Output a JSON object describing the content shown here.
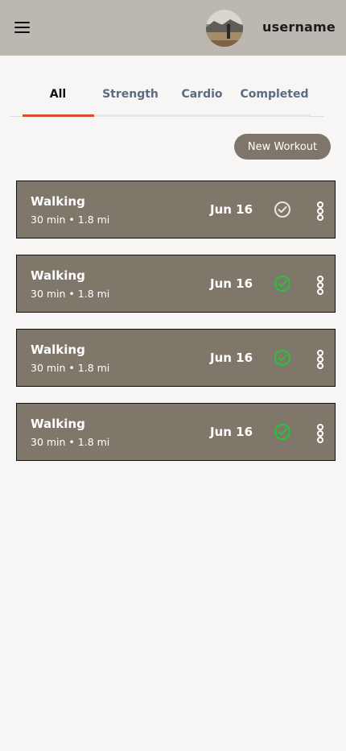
{
  "header": {
    "username": "username",
    "menu_icon": "hamburger-menu-icon",
    "avatar": "profile-photo"
  },
  "tabs": [
    {
      "label": "All",
      "active": true
    },
    {
      "label": "Strength",
      "active": false
    },
    {
      "label": "Cardio",
      "active": false
    },
    {
      "label": "Completed",
      "active": false
    }
  ],
  "new_workout_label": "New Workout",
  "workouts": [
    {
      "title": "Walking",
      "meta": "30 min • 1.8 mi",
      "date": "Jun 16",
      "completed": false
    },
    {
      "title": "Walking",
      "meta": "30 min • 1.8 mi",
      "date": "Jun 16",
      "completed": true
    },
    {
      "title": "Walking",
      "meta": "30 min • 1.8 mi",
      "date": "Jun 16",
      "completed": true
    },
    {
      "title": "Walking",
      "meta": "30 min • 1.8 mi",
      "date": "Jun 16",
      "completed": true
    }
  ],
  "colors": {
    "header_bg": "#bcb7b0",
    "card_bg": "#7f776a",
    "accent": "#d94a32",
    "check_done": "#22c43a",
    "check_pending": "#e6e6e6"
  }
}
